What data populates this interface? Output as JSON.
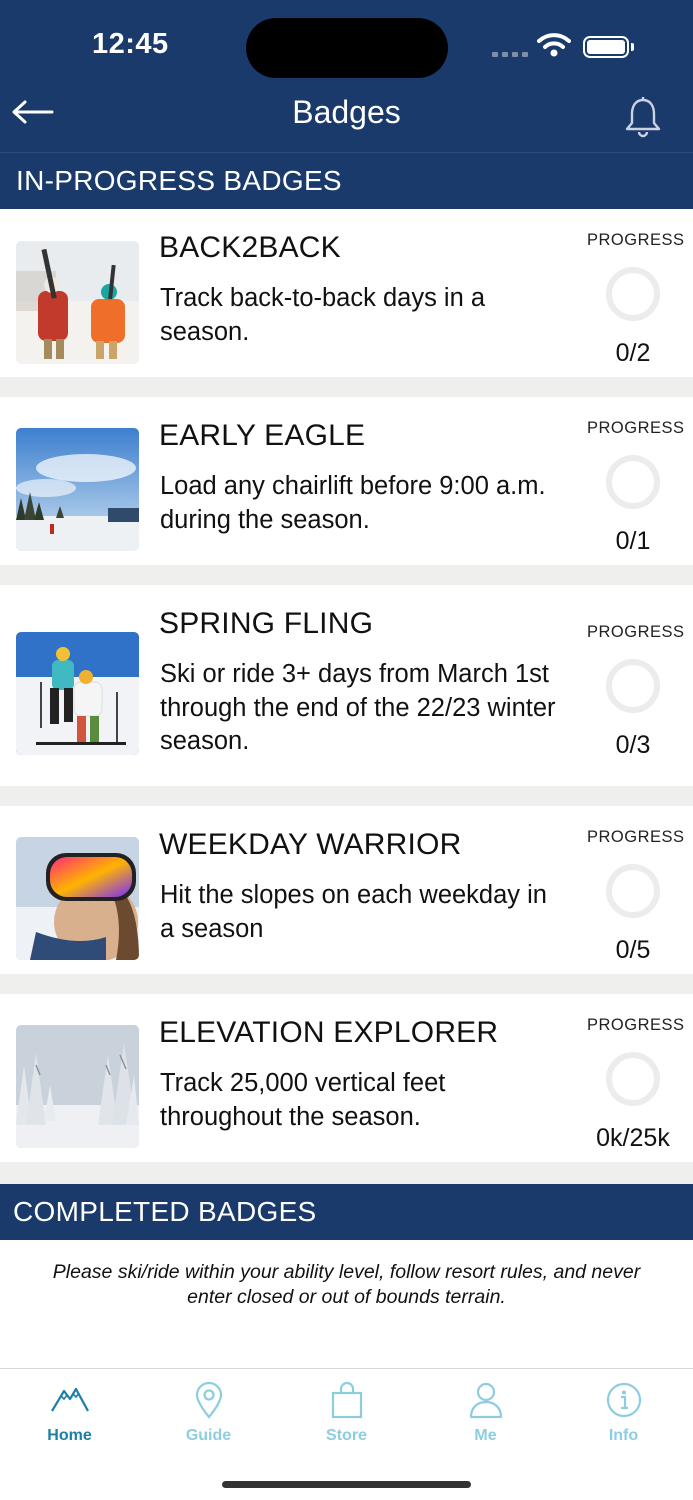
{
  "status_bar": {
    "time": "12:45"
  },
  "header": {
    "title": "Badges"
  },
  "sections": {
    "in_progress": "IN-PROGRESS BADGES",
    "completed": "COMPLETED BADGES"
  },
  "badges": [
    {
      "title": "BACK2BACK",
      "description": "Track back-to-back days in a season.",
      "progress_label": "PROGRESS",
      "progress": "0/2",
      "progress_fraction": 0
    },
    {
      "title": "EARLY EAGLE",
      "description": "Load any chairlift before 9:00 a.m. during the season.",
      "progress_label": "PROGRESS",
      "progress": "0/1",
      "progress_fraction": 0
    },
    {
      "title": "SPRING FLING",
      "description": "Ski or ride 3+ days from March 1st through the end of the 22/23 winter season.",
      "progress_label": "PROGRESS",
      "progress": "0/3",
      "progress_fraction": 0
    },
    {
      "title": "WEEKDAY WARRIOR",
      "description": "Hit the slopes on each weekday in a season",
      "progress_label": "PROGRESS",
      "progress": "0/5",
      "progress_fraction": 0
    },
    {
      "title": "ELEVATION EXPLORER",
      "description": "Track 25,000 vertical feet throughout the season.",
      "progress_label": "PROGRESS",
      "progress": "0k/25k",
      "progress_fraction": 0
    }
  ],
  "disclaimer": "Please ski/ride within your ability level, follow resort rules, and never enter closed or out of bounds terrain.",
  "tabs": [
    {
      "label": "Home",
      "icon": "mountain-icon",
      "active": true
    },
    {
      "label": "Guide",
      "icon": "map-pin-icon",
      "active": false
    },
    {
      "label": "Store",
      "icon": "shopping-bag-icon",
      "active": false
    },
    {
      "label": "Me",
      "icon": "person-icon",
      "active": false
    },
    {
      "label": "Info",
      "icon": "info-icon",
      "active": false
    }
  ],
  "colors": {
    "header_bg": "#1a3a6b",
    "tab_active": "#1b7fa6",
    "tab_inactive": "#8ccde0",
    "row_divider": "#efefed",
    "progress_ring": "#ececea"
  }
}
